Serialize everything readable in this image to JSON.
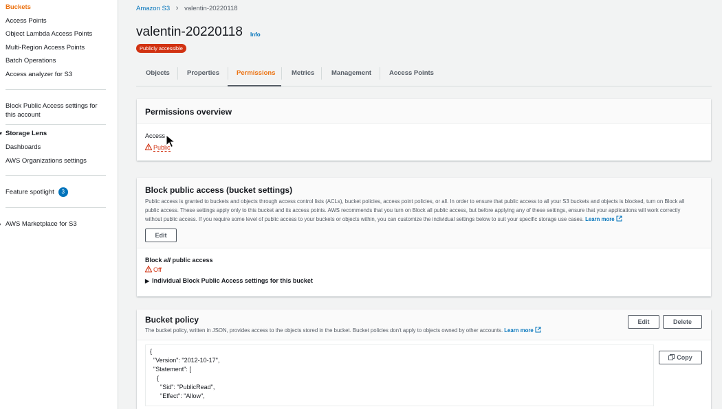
{
  "sidebar": {
    "items": [
      {
        "label": "Buckets"
      },
      {
        "label": "Access Points"
      },
      {
        "label": "Object Lambda Access Points"
      },
      {
        "label": "Multi-Region Access Points"
      },
      {
        "label": "Batch Operations"
      },
      {
        "label": "Access analyzer for S3"
      },
      {
        "label": "Block Public Access settings for"
      },
      {
        "label": "this account"
      },
      {
        "label": "Storage Lens"
      },
      {
        "label": "Dashboards"
      },
      {
        "label": "AWS Organizations settings"
      },
      {
        "label": "Feature spotlight"
      },
      {
        "label": "AWS Marketplace for S3"
      }
    ],
    "feature_badge": "3"
  },
  "breadcrumb": {
    "root": "Amazon S3",
    "current": "valentin-20220118"
  },
  "header": {
    "title": "valentin-20220118",
    "info": "Info",
    "badge": "Publicly accessible"
  },
  "tabs": [
    "Objects",
    "Properties",
    "Permissions",
    "Metrics",
    "Management",
    "Access Points"
  ],
  "active_tab": "Permissions",
  "overview": {
    "title": "Permissions overview",
    "access_label": "Access",
    "access_value": "Public"
  },
  "block_access": {
    "title": "Block public access (bucket settings)",
    "desc_lines": [
      "Public access is granted to buckets and objects through access control lists (ACLs), bucket policies, access point policies, or all. In order to ensure that public access to all your S3 buckets and objects is blocked, turn on Block all",
      "public access. These settings apply only to this bucket and its access points. AWS recommends that you turn on Block all public access, but before applying any of these settings, ensure that your applications will work correctly",
      "without public access. If you require some level of public access to your buckets or objects within, you can customize the individual settings below to suit your specific storage use cases."
    ],
    "learn_more": "Learn more",
    "edit": "Edit",
    "block_all_pre": "Block ",
    "block_all_em": "all",
    "block_all_post": " public access",
    "status": "Off",
    "individual": "Individual Block Public Access settings for this bucket"
  },
  "policy": {
    "title": "Bucket policy",
    "desc": "The bucket policy, written in JSON, provides access to the objects stored in the bucket. Bucket policies don't apply to objects owned by other accounts.",
    "learn_more": "Learn more",
    "edit": "Edit",
    "delete": "Delete",
    "copy": "Copy",
    "json_lines": [
      "{",
      "  \"Version\": \"2012-10-17\",",
      "  \"Statement\": [",
      "    {",
      "      \"Sid\": \"PublicRead\",",
      "      \"Effect\": \"Allow\","
    ]
  },
  "colors": {
    "accent": "#ec7211",
    "link": "#0073bb",
    "danger": "#d13212"
  },
  "icons": [
    "warning-icon",
    "external-link-icon",
    "copy-icon",
    "caret-right-icon",
    "caret-down-icon",
    "chevron-right-icon",
    "mouse-cursor-icon"
  ]
}
